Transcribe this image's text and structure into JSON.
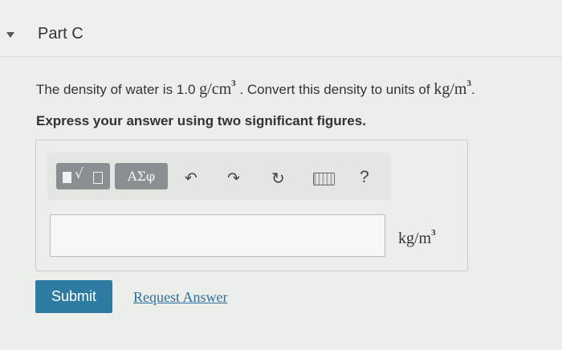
{
  "part": {
    "title": "Part C"
  },
  "question": {
    "prefix": "The density of water is 1.0",
    "value_unit_base": "g/cm",
    "value_unit_exp": "3",
    "middle": ". Convert this density to units of",
    "target_unit_base": "kg/m",
    "target_unit_exp": "3",
    "suffix": "."
  },
  "instruction": "Express your answer using two significant figures.",
  "toolbar": {
    "greek_label": "ΑΣφ",
    "icons": [
      "template-icon",
      "undo-icon",
      "redo-icon",
      "reset-icon",
      "keyboard-icon",
      "help-icon"
    ],
    "help_label": "?"
  },
  "answer": {
    "value": "",
    "unit_base": "kg/m",
    "unit_exp": "3"
  },
  "actions": {
    "submit_label": "Submit",
    "request_label": "Request Answer"
  },
  "colors": {
    "submit_bg": "#2e7ba1",
    "link": "#2e6f9a",
    "toolbar_button": "#8a8f92"
  }
}
